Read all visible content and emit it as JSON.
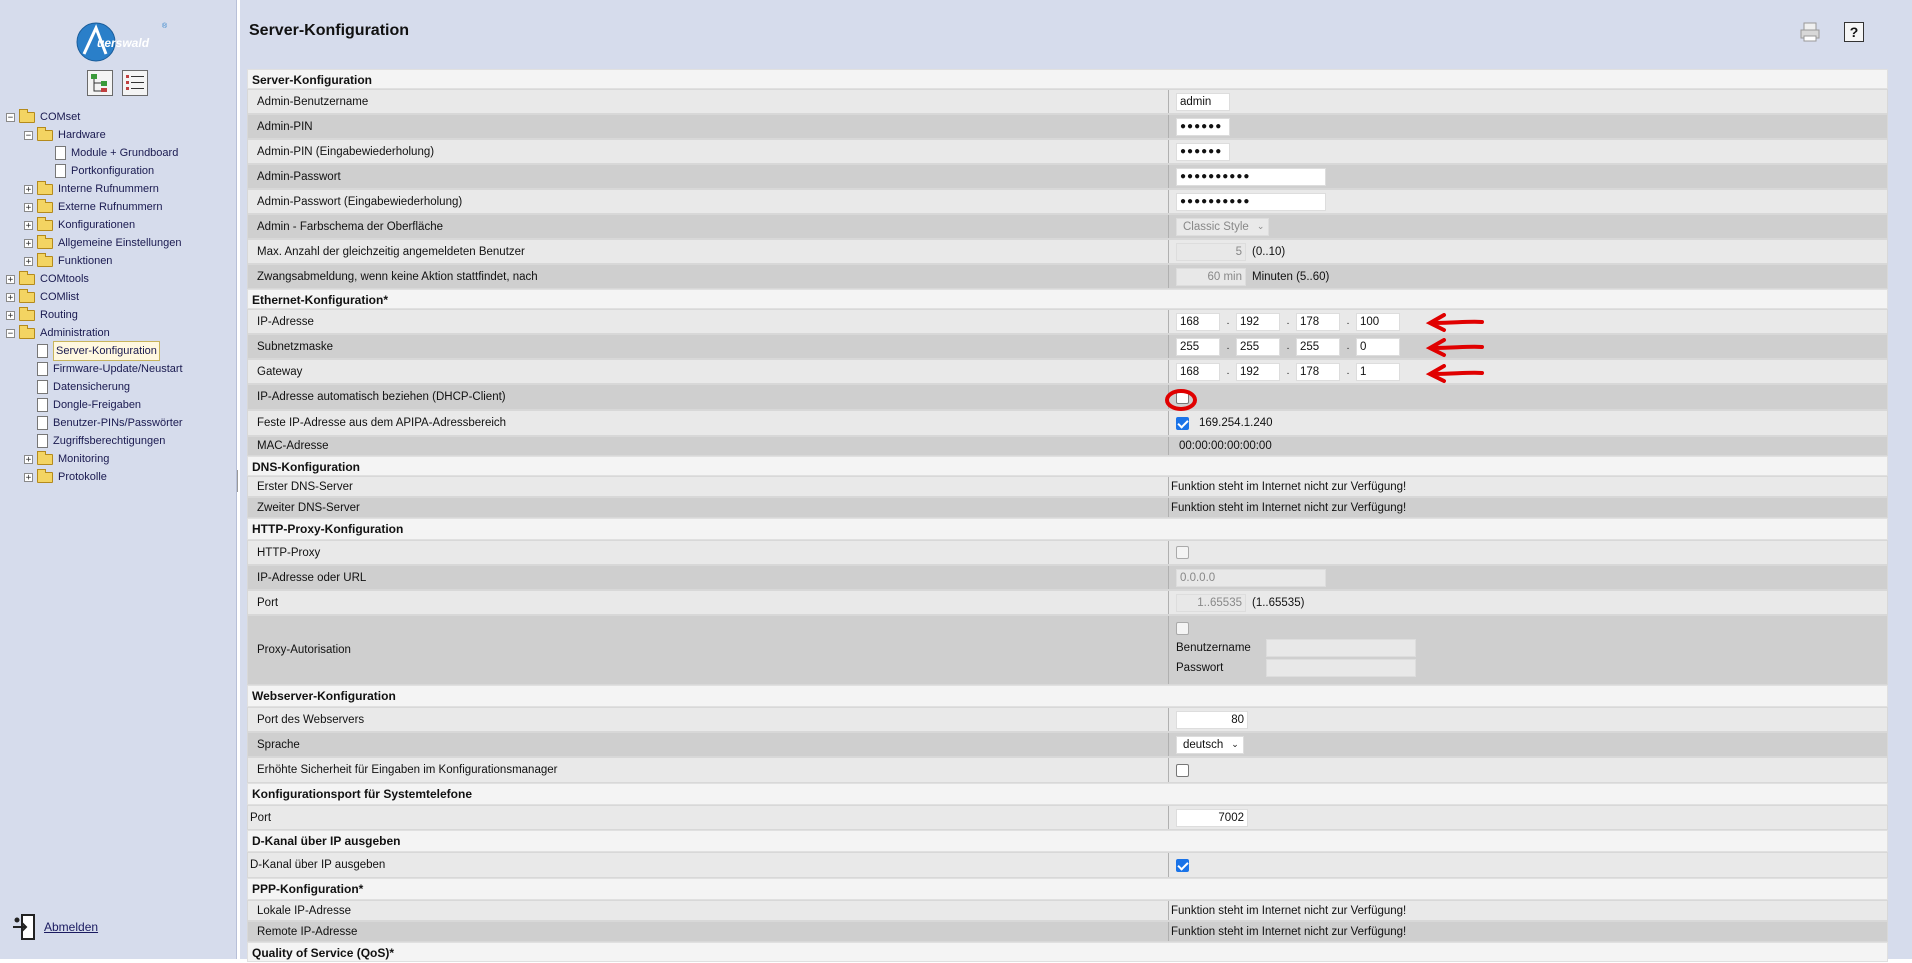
{
  "sidebar": {
    "logo_text": "Auerswald",
    "tree": [
      {
        "label": "COMset",
        "toggle": "−",
        "kind": "folder",
        "level": 0
      },
      {
        "label": "Hardware",
        "toggle": "−",
        "kind": "folder",
        "level": 1
      },
      {
        "label": "Module + Grundboard",
        "toggle": "",
        "kind": "doc",
        "level": 2
      },
      {
        "label": "Portkonfiguration",
        "toggle": "",
        "kind": "doc",
        "level": 2
      },
      {
        "label": "Interne Rufnummern",
        "toggle": "+",
        "kind": "folder",
        "level": 1
      },
      {
        "label": "Externe Rufnummern",
        "toggle": "+",
        "kind": "folder",
        "level": 1
      },
      {
        "label": "Konfigurationen",
        "toggle": "+",
        "kind": "folder",
        "level": 1
      },
      {
        "label": "Allgemeine Einstellungen",
        "toggle": "+",
        "kind": "folder",
        "level": 1
      },
      {
        "label": "Funktionen",
        "toggle": "+",
        "kind": "folder",
        "level": 1
      },
      {
        "label": "COMtools",
        "toggle": "+",
        "kind": "folder",
        "level": 0
      },
      {
        "label": "COMlist",
        "toggle": "+",
        "kind": "folder",
        "level": 0
      },
      {
        "label": "Routing",
        "toggle": "+",
        "kind": "folder",
        "level": 0
      },
      {
        "label": "Administration",
        "toggle": "−",
        "kind": "folder",
        "level": 0
      },
      {
        "label": "Server-Konfiguration",
        "toggle": "",
        "kind": "doc",
        "level": 1,
        "active": true
      },
      {
        "label": "Firmware-Update/Neustart",
        "toggle": "",
        "kind": "doc",
        "level": 1
      },
      {
        "label": "Datensicherung",
        "toggle": "",
        "kind": "doc",
        "level": 1
      },
      {
        "label": "Dongle-Freigaben",
        "toggle": "",
        "kind": "doc",
        "level": 1
      },
      {
        "label": "Benutzer-PINs/Passwörter",
        "toggle": "",
        "kind": "doc",
        "level": 1
      },
      {
        "label": "Zugriffsberechtigungen",
        "toggle": "",
        "kind": "doc",
        "level": 1
      },
      {
        "label": "Monitoring",
        "toggle": "+",
        "kind": "folder",
        "level": 1
      },
      {
        "label": "Protokolle",
        "toggle": "+",
        "kind": "folder",
        "level": 1
      }
    ],
    "logout_label": "Abmelden"
  },
  "header": {
    "title": "Server-Konfiguration",
    "help_label": "?"
  },
  "form": {
    "server_section": "Server-Konfiguration",
    "admin_user_label": "Admin-Benutzername",
    "admin_user_value": "admin",
    "admin_pin_label": "Admin-PIN",
    "admin_pin_value": "●●●●●●",
    "admin_pin_repeat_label": "Admin-PIN (Eingabewiederholung)",
    "admin_pin_repeat_value": "●●●●●●",
    "admin_pw_label": "Admin-Passwort",
    "admin_pw_value": "●●●●●●●●●●",
    "admin_pw_repeat_label": "Admin-Passwort (Eingabewiederholung)",
    "admin_pw_repeat_value": "●●●●●●●●●●",
    "color_scheme_label": "Admin - Farbschema der Oberfläche",
    "color_scheme_value": "Classic Style",
    "max_users_label": "Max. Anzahl der gleichzeitig angemeldeten Benutzer",
    "max_users_value": "5",
    "max_users_hint": "(0..10)",
    "logout_timeout_label": "Zwangsabmeldung, wenn keine Aktion stattfindet, nach",
    "logout_timeout_value": "60 min",
    "logout_timeout_hint": "Minuten (5..60)",
    "ethernet_section": "Ethernet-Konfiguration*",
    "ip_label": "IP-Adresse",
    "ip_values": [
      "168",
      "192",
      "178",
      "100"
    ],
    "subnet_label": "Subnetzmaske",
    "subnet_values": [
      "255",
      "255",
      "255",
      "0"
    ],
    "gateway_label": "Gateway",
    "gateway_values": [
      "168",
      "192",
      "178",
      "1"
    ],
    "dot": ".",
    "dhcp_label": "IP-Adresse automatisch beziehen (DHCP-Client)",
    "dhcp_checked": false,
    "apipa_label": "Feste IP-Adresse aus dem APIPA-Adressbereich",
    "apipa_checked": true,
    "apipa_value": "169.254.1.240",
    "mac_label": "MAC-Adresse",
    "mac_value": "00:00:00:00:00:00",
    "dns_section": "DNS-Konfiguration",
    "dns1_label": "Erster DNS-Server",
    "dns1_value": "Funktion steht im Internet nicht zur Verfügung!",
    "dns2_label": "Zweiter DNS-Server",
    "dns2_value": "Funktion steht im Internet nicht zur Verfügung!",
    "proxy_section": "HTTP-Proxy-Konfiguration",
    "proxy_label": "HTTP-Proxy",
    "proxy_url_label": "IP-Adresse oder URL",
    "proxy_url_value": "0.0.0.0",
    "proxy_port_label": "Port",
    "proxy_port_value": "1..65535",
    "proxy_port_hint": "(1..65535)",
    "proxy_auth_label": "Proxy-Autorisation",
    "proxy_user_label": "Benutzername",
    "proxy_pass_label": "Passwort",
    "web_section": "Webserver-Konfiguration",
    "web_port_label": "Port des Webservers",
    "web_port_value": "80",
    "language_label": "Sprache",
    "language_value": "deutsch",
    "security_label": "Erhöhte Sicherheit für Eingaben im Konfigurationsmanager",
    "sysphone_section": "Konfigurationsport für Systemtelefone",
    "sysphone_port_label": "Port",
    "sysphone_port_value": "7002",
    "dchannel_section": "D-Kanal über IP ausgeben",
    "dchannel_label": "D-Kanal über IP ausgeben",
    "dchannel_checked": true,
    "ppp_section": "PPP-Konfiguration*",
    "ppp_local_label": "Lokale IP-Adresse",
    "ppp_local_value": "Funktion steht im Internet nicht zur Verfügung!",
    "ppp_remote_label": "Remote IP-Adresse",
    "ppp_remote_value": "Funktion steht im Internet nicht zur Verfügung!",
    "qos_section": "Quality of Service (QoS)*"
  },
  "annotations": {
    "marker_color": "#e00000"
  }
}
